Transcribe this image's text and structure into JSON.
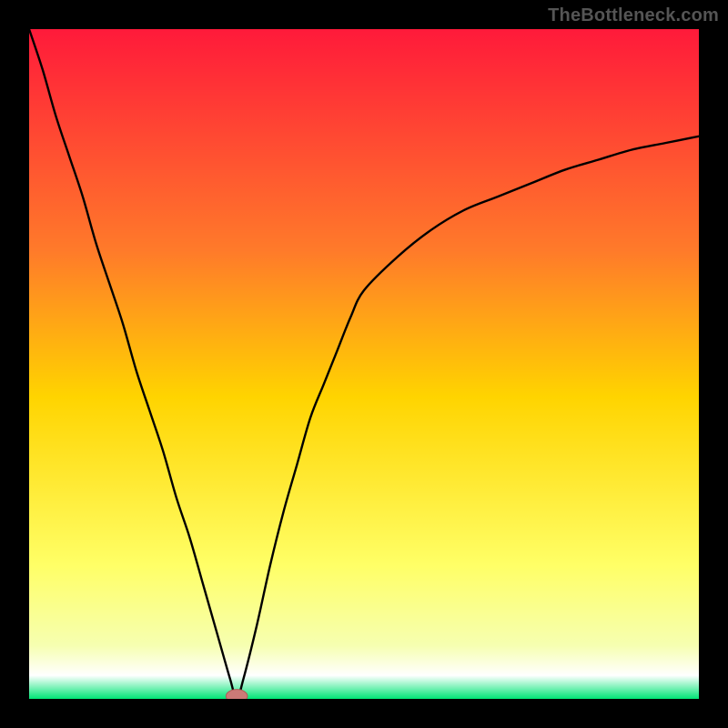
{
  "watermark": "TheBottleneck.com",
  "colors": {
    "frame": "#000000",
    "grad_top": "#ff1a3a",
    "grad_upper_mid": "#ff7a2a",
    "grad_mid": "#ffd400",
    "grad_lower_mid": "#ffff66",
    "grad_pale": "#f6ffb0",
    "grad_base": "#00e676",
    "curve": "#000000",
    "marker_fill": "#cc7a77",
    "marker_stroke": "#b05a57"
  },
  "chart_data": {
    "type": "line",
    "title": "",
    "xlabel": "",
    "ylabel": "",
    "xlim": [
      0,
      100
    ],
    "ylim": [
      0,
      100
    ],
    "annotations": [],
    "series": [
      {
        "name": "bottleneck-curve",
        "x": [
          0,
          2,
          4,
          6,
          8,
          10,
          12,
          14,
          16,
          18,
          20,
          22,
          24,
          26,
          28,
          30,
          31,
          32,
          34,
          36,
          38,
          40,
          42,
          44,
          46,
          48,
          50,
          55,
          60,
          65,
          70,
          75,
          80,
          85,
          90,
          95,
          100
        ],
        "y": [
          100,
          94,
          87,
          81,
          75,
          68,
          62,
          56,
          49,
          43,
          37,
          30,
          24,
          17,
          10,
          3,
          0,
          3,
          11,
          20,
          28,
          35,
          42,
          47,
          52,
          57,
          61,
          66,
          70,
          73,
          75,
          77,
          79,
          80.5,
          82,
          83,
          84
        ]
      }
    ],
    "marker": {
      "x": 31,
      "y": 0,
      "rx": 1.6,
      "ry": 1.0
    },
    "gradient_stops": [
      {
        "offset": 0.0,
        "color": "#ff1a3a"
      },
      {
        "offset": 0.33,
        "color": "#ff7a2a"
      },
      {
        "offset": 0.55,
        "color": "#ffd400"
      },
      {
        "offset": 0.8,
        "color": "#ffff66"
      },
      {
        "offset": 0.92,
        "color": "#f6ffb0"
      },
      {
        "offset": 0.965,
        "color": "#ffffff"
      },
      {
        "offset": 1.0,
        "color": "#00e676"
      }
    ]
  }
}
